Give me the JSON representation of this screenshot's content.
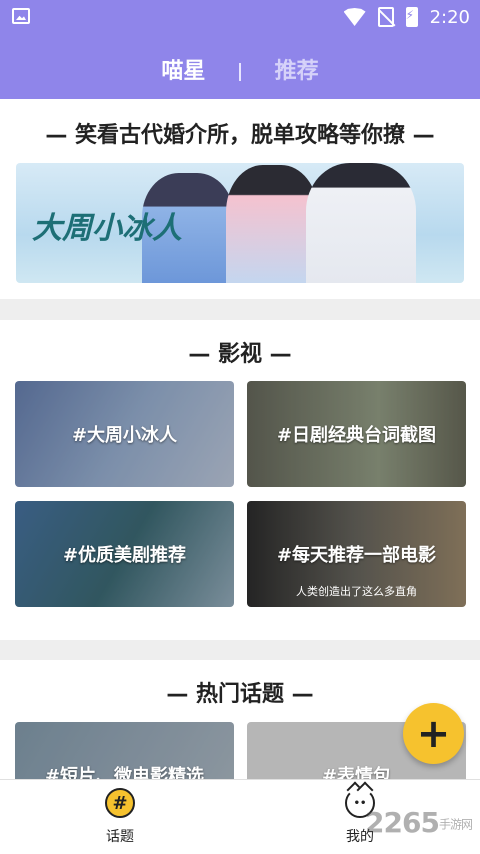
{
  "status": {
    "time": "2:20"
  },
  "header": {
    "tab_active": "喵星",
    "tab_inactive": "推荐"
  },
  "sections": {
    "featured_title": "— 笑看古代婚介所，脱单攻略等你撩 —",
    "banner_logo": "大周小冰人",
    "film_title": "— 影视 —",
    "film_items": [
      {
        "label": "#大周小冰人"
      },
      {
        "label": "#日剧经典台词截图"
      },
      {
        "label": "#优质美剧推荐"
      },
      {
        "label": "#每天推荐一部电影",
        "subtitle": "人类创造出了这么多直角"
      }
    ],
    "hot_title": "— 热门话题 —",
    "hot_items": [
      {
        "label": "#短片、微电影精选"
      },
      {
        "label": "#表情包"
      }
    ]
  },
  "fab": {
    "label": "+"
  },
  "bottom_nav": {
    "items": [
      {
        "label": "话题",
        "icon": "hash-icon",
        "glyph": "#"
      },
      {
        "label": "我的",
        "icon": "cat-icon",
        "glyph": "••"
      }
    ]
  },
  "watermark": {
    "text": "2265",
    "sub": "手游网"
  },
  "colors": {
    "header": "#8f85ea",
    "accent": "#f6c22e"
  }
}
